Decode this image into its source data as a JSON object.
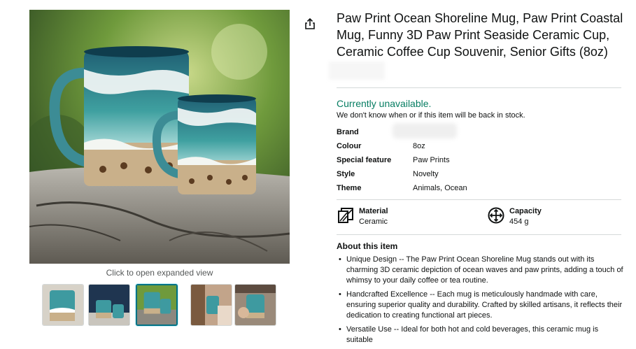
{
  "gallery": {
    "caption": "Click to open expanded view",
    "thumbnails": [
      "thumb-1",
      "thumb-2",
      "thumb-3",
      "thumb-4",
      "thumb-5"
    ],
    "selected_thumbnail": 3
  },
  "product": {
    "title": "Paw Print Ocean Shoreline Mug, Paw Print Coastal Mug, Funny 3D Paw Print Seaside Ceramic Cup, Ceramic Coffee Cup Souvenir, Senior Gifts (8oz)"
  },
  "availability": {
    "status": "Currently unavailable.",
    "note": "We don't know when or if this item will be back in stock."
  },
  "specs": [
    {
      "key": "Brand",
      "value": ""
    },
    {
      "key": "Colour",
      "value": "8oz"
    },
    {
      "key": "Special feature",
      "value": "Paw Prints"
    },
    {
      "key": "Style",
      "value": "Novelty"
    },
    {
      "key": "Theme",
      "value": "Animals, Ocean"
    }
  ],
  "features": [
    {
      "label": "Material",
      "value": "Ceramic",
      "icon": "material-icon"
    },
    {
      "label": "Capacity",
      "value": "454 g",
      "icon": "capacity-icon"
    }
  ],
  "about": {
    "title": "About this item",
    "bullets": [
      "Unique Design -- The Paw Print Ocean Shoreline Mug stands out with its charming 3D ceramic depiction of ocean waves and paw prints, adding a touch of whimsy to your daily coffee or tea routine.",
      "Handcrafted Excellence -- Each mug is meticulously handmade with care, ensuring superior quality and durability. Crafted by skilled artisans, it reflects their dedication to creating functional art pieces.",
      "Versatile Use -- Ideal for both hot and cold beverages, this ceramic mug is suitable"
    ]
  },
  "colors": {
    "availability_green": "#067d62",
    "selected_thumb_border": "#007185",
    "divider": "#d5d9d9"
  }
}
